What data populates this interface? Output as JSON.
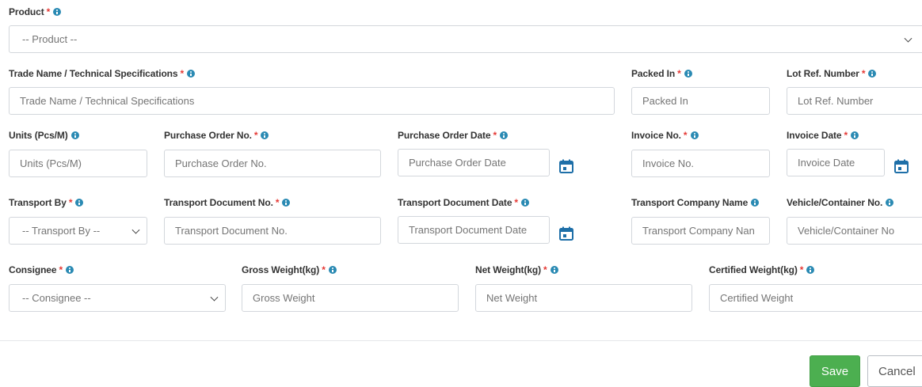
{
  "product": {
    "label": "Product",
    "placeholder": "-- Product --"
  },
  "trade_name": {
    "label": "Trade Name / Technical Specifications",
    "placeholder": "Trade Name / Technical Specifications"
  },
  "packed_in": {
    "label": "Packed In",
    "placeholder": "Packed In"
  },
  "lot_ref": {
    "label": "Lot Ref. Number",
    "placeholder": "Lot Ref. Number"
  },
  "units": {
    "label": "Units (Pcs/M)",
    "placeholder": "Units (Pcs/M)"
  },
  "po_no": {
    "label": "Purchase Order No.",
    "placeholder": "Purchase Order No."
  },
  "po_date": {
    "label": "Purchase Order Date",
    "placeholder": "Purchase Order Date"
  },
  "invoice_no": {
    "label": "Invoice No.",
    "placeholder": "Invoice No."
  },
  "invoice_date": {
    "label": "Invoice Date",
    "placeholder": "Invoice Date"
  },
  "transport_by": {
    "label": "Transport By",
    "placeholder": "-- Transport By --"
  },
  "transport_doc_no": {
    "label": "Transport Document No.",
    "placeholder": "Transport Document No."
  },
  "transport_doc_date": {
    "label": "Transport Document Date",
    "placeholder": "Transport Document Date"
  },
  "transport_company": {
    "label": "Transport Company Name",
    "placeholder": "Transport Company Nan"
  },
  "vehicle_no": {
    "label": "Vehicle/Container No.",
    "placeholder": "Vehicle/Container No"
  },
  "consignee": {
    "label": "Consignee",
    "placeholder": "-- Consignee --"
  },
  "gross_weight": {
    "label": "Gross Weight(kg)",
    "placeholder": "Gross Weight"
  },
  "net_weight": {
    "label": "Net Weight(kg)",
    "placeholder": "Net Weight"
  },
  "certified_weight": {
    "label": "Certified Weight(kg)",
    "placeholder": "Certified Weight"
  },
  "required_mark": "*",
  "actions": {
    "save": "Save",
    "cancel": "Cancel"
  },
  "colors": {
    "required": "#e53935",
    "info": "#2a8ab3",
    "calendar": "#1e6fa8",
    "save": "#4caf50"
  },
  "icons": {
    "info": "info-icon",
    "calendar": "calendar-icon",
    "dropdown": "chevron-down-icon"
  }
}
